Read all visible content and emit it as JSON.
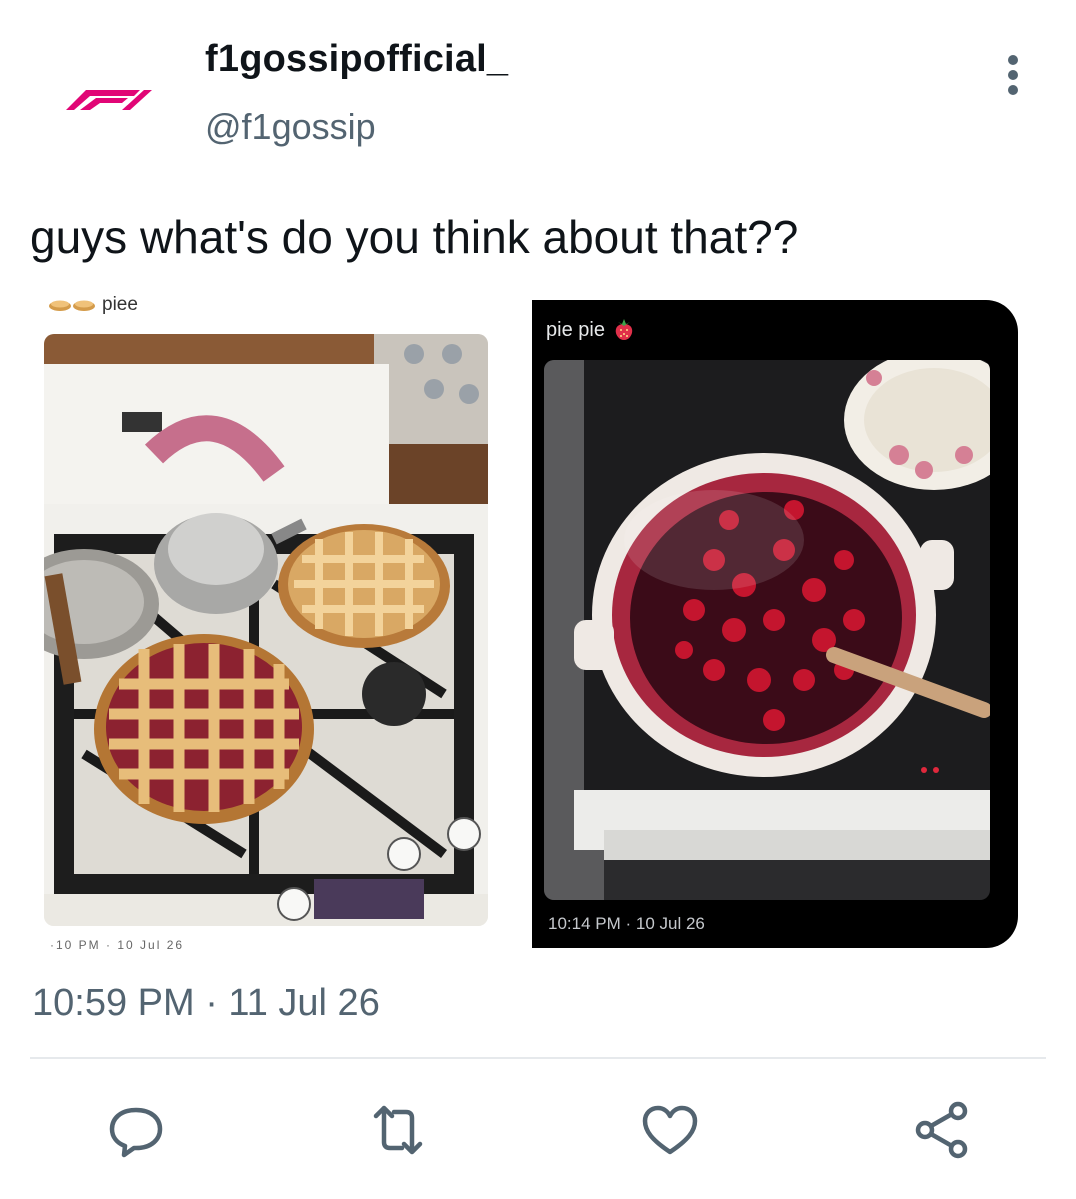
{
  "colors": {
    "brand": "#e10676",
    "text": "#0f1419",
    "muted": "#536471",
    "divider": "#e6e9ec"
  },
  "header": {
    "avatar_icon": "f1-logo-icon",
    "display_name": "f1gossipofficial_",
    "handle": "@f1gossip",
    "more_icon": "more-vertical-icon"
  },
  "tweet": {
    "text": "guys what's do you think about that??",
    "timestamp": "10:59 PM · 11 Jul 26"
  },
  "media": {
    "left": {
      "caption": "piee",
      "caption_icons": [
        "pie-icon",
        "pie-icon"
      ],
      "image": "photo of two lattice cherry pies on a gas stove beside a kettle",
      "time_partial": "·10 PM · 10 Jul 26"
    },
    "right": {
      "caption": "pie pie",
      "caption_icon": "strawberry-icon",
      "image": "photo of a steaming pot of cherry filling on a stovetop",
      "time": "10:14 PM · 10 Jul 26"
    }
  },
  "actions": [
    {
      "icon": "reply-icon"
    },
    {
      "icon": "retweet-icon"
    },
    {
      "icon": "like-icon"
    },
    {
      "icon": "share-icon"
    }
  ]
}
